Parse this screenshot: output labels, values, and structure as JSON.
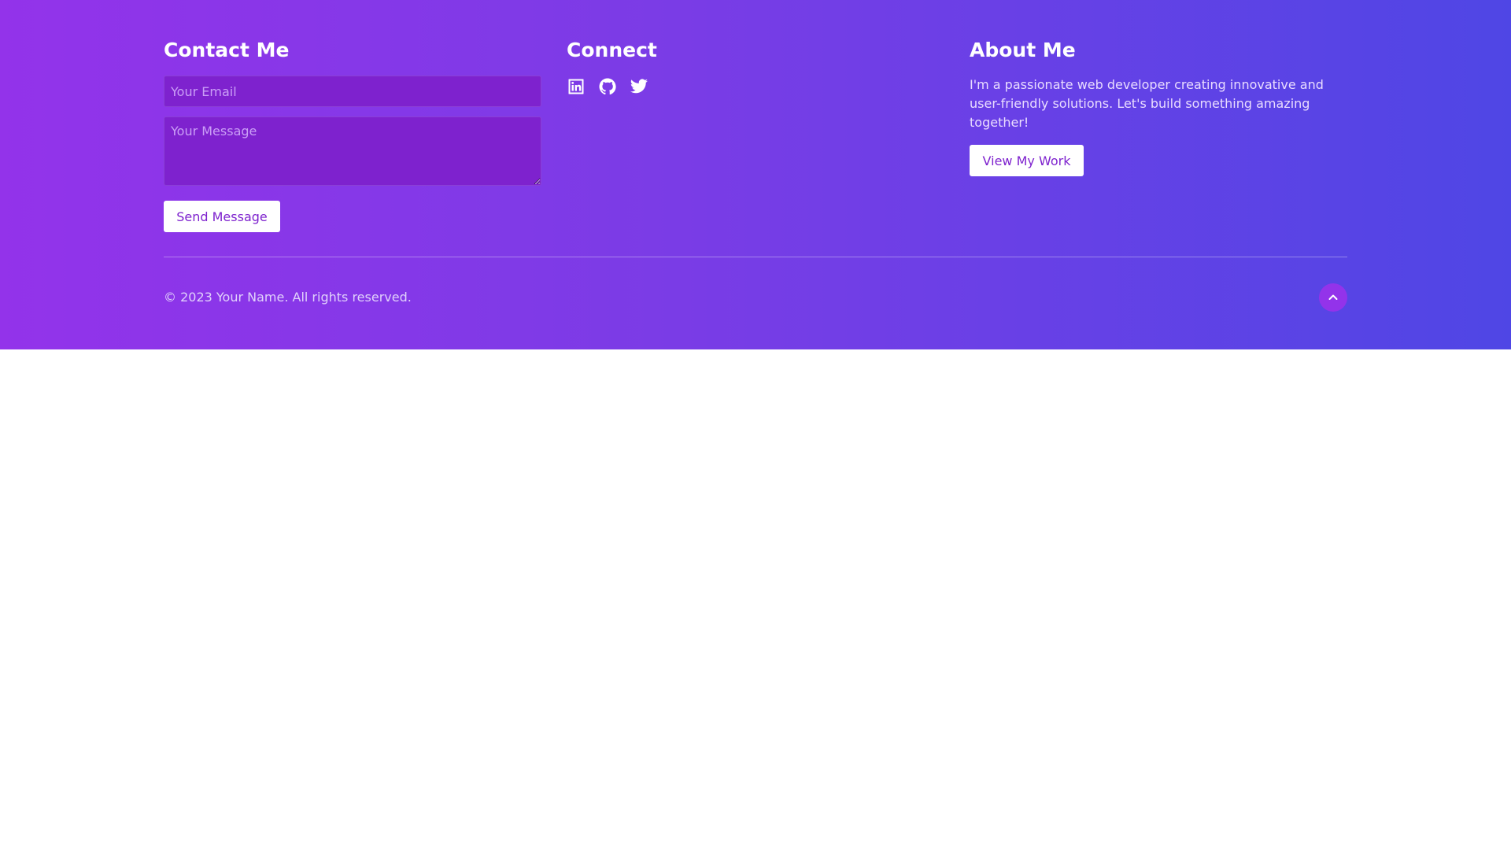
{
  "colors": {
    "gradient_start": "#9333ea",
    "gradient_end": "#4f46e5",
    "input_bg": "#7e22ce",
    "button_bg": "#ffffff",
    "button_text": "#7e22ce",
    "back_to_top_bg": "#9333ea"
  },
  "contact": {
    "heading": "Contact Me",
    "email_placeholder": "Your Email",
    "email_value": "",
    "message_placeholder": "Your Message",
    "message_value": "",
    "send_label": "Send Message"
  },
  "connect": {
    "heading": "Connect",
    "icons": [
      "linkedin-icon",
      "github-icon",
      "twitter-icon"
    ]
  },
  "about": {
    "heading": "About Me",
    "text": "I'm a passionate web developer creating innovative and user-friendly solutions. Let's build something amazing together!",
    "button_label": "View My Work"
  },
  "bottom": {
    "copyright": "© 2023 Your Name. All rights reserved.",
    "back_to_top_icon": "chevron-up-icon"
  }
}
